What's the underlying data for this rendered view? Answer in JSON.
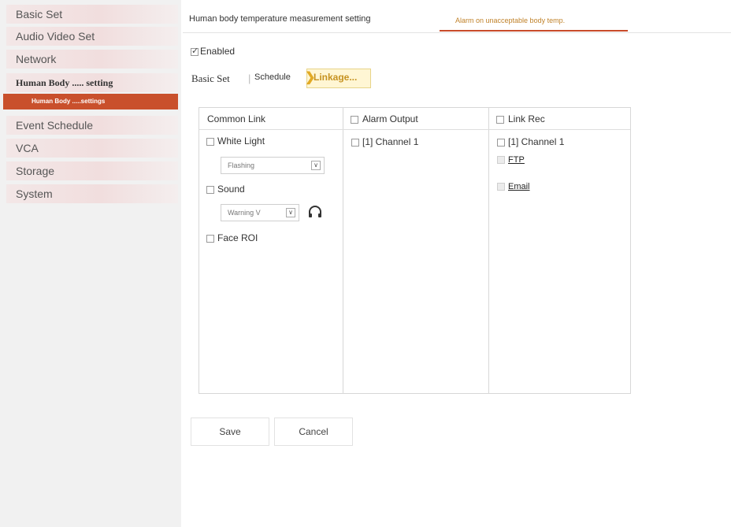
{
  "sidebar": {
    "items": [
      {
        "label": "Basic Set"
      },
      {
        "label": "Audio Video Set"
      },
      {
        "label": "Network"
      },
      {
        "label": "Human Body ..... setting"
      },
      {
        "label": "Event Schedule"
      },
      {
        "label": "VCA"
      },
      {
        "label": "Storage"
      },
      {
        "label": "System"
      }
    ],
    "submenu": {
      "label": "Human Body .....settings"
    }
  },
  "top_tabs": [
    {
      "label": "Human body temperature measurement setting"
    },
    {
      "label": "Alarm on unacceptable body temp."
    }
  ],
  "enabled": {
    "label": "Enabled",
    "checked": true
  },
  "sub_tabs": [
    {
      "label": "Basic Set"
    },
    {
      "label": "Schedule"
    },
    {
      "label": "Linkage..."
    }
  ],
  "linkage": {
    "common_link": {
      "header": "Common Link",
      "white_light": {
        "label": "White Light",
        "mode": "Flashing"
      },
      "sound": {
        "label": "Sound",
        "tone": "Warning V"
      },
      "face_roi": {
        "label": "Face ROI"
      }
    },
    "alarm_output": {
      "header": "Alarm Output",
      "items": [
        {
          "label": "[1] Channel 1"
        }
      ]
    },
    "link_rec": {
      "header": "Link Rec",
      "items": [
        {
          "label": "[1] Channel 1"
        }
      ],
      "ftp": "FTP",
      "email": "Email"
    }
  },
  "buttons": {
    "save": "Save",
    "cancel": "Cancel"
  },
  "colors": {
    "accent": "#c9502c",
    "active_tab_text": "#c0822a",
    "linkage_tab_bg": "#fff6d4"
  }
}
